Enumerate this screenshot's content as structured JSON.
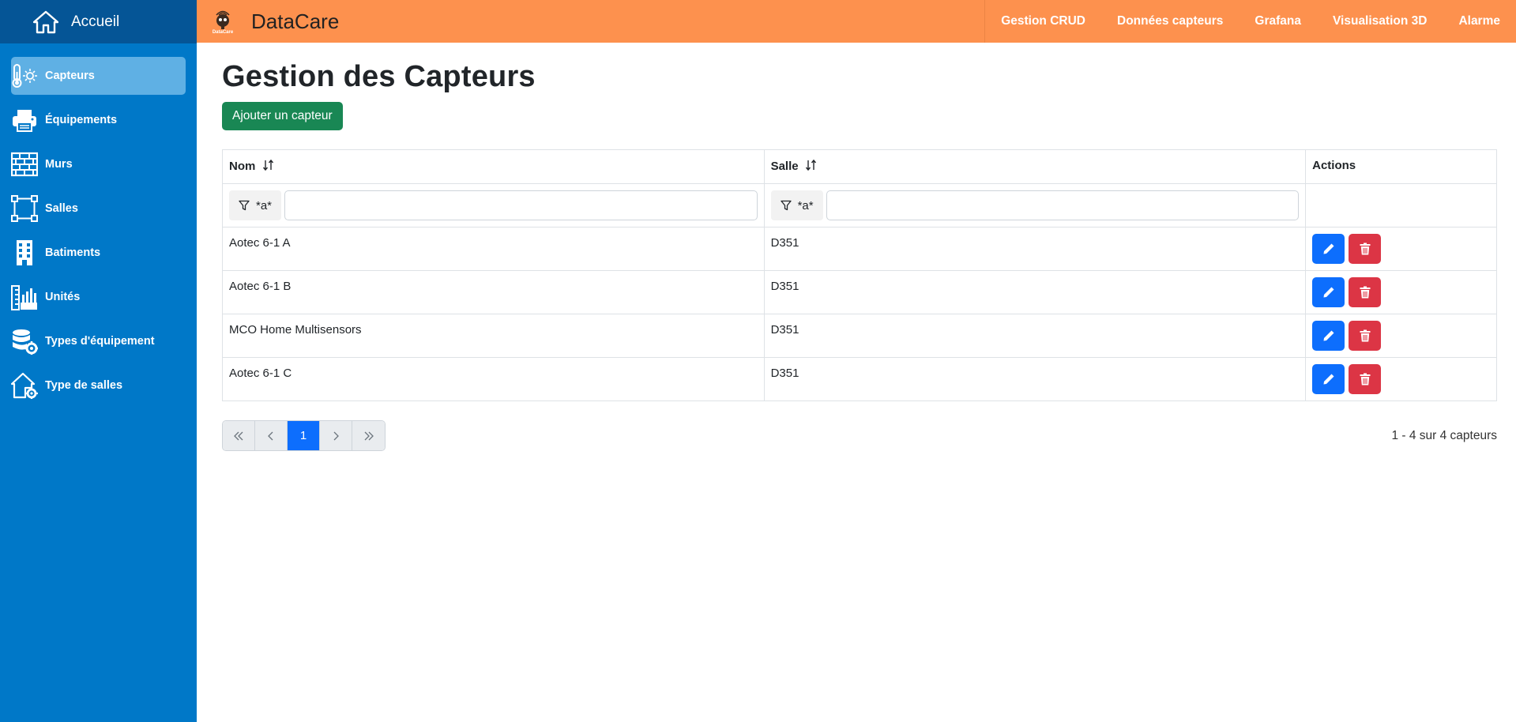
{
  "sidebar": {
    "home_label": "Accueil",
    "items": [
      {
        "label": "Capteurs",
        "icon": "thermometer-icon",
        "active": true
      },
      {
        "label": "Équipements",
        "icon": "printer-icon",
        "active": false
      },
      {
        "label": "Murs",
        "icon": "brick-wall-icon",
        "active": false
      },
      {
        "label": "Salles",
        "icon": "vector-square-icon",
        "active": false
      },
      {
        "label": "Batiments",
        "icon": "building-icon",
        "active": false
      },
      {
        "label": "Unités",
        "icon": "ruler-icon",
        "active": false
      },
      {
        "label": "Types d'équipement",
        "icon": "database-gear-icon",
        "active": false
      },
      {
        "label": "Type de salles",
        "icon": "house-gear-icon",
        "active": false
      }
    ]
  },
  "topbar": {
    "logo_text": "DataCare",
    "brand": "DataCare",
    "nav": [
      "Gestion CRUD",
      "Données capteurs",
      "Grafana",
      "Visualisation 3D",
      "Alarme"
    ]
  },
  "main": {
    "title": "Gestion des Capteurs",
    "add_button": "Ajouter un capteur",
    "table": {
      "headers": [
        "Nom",
        "Salle",
        "Actions"
      ],
      "filter_label": "*a*",
      "rows": [
        {
          "nom": "Aotec 6-1 A",
          "salle": "D351"
        },
        {
          "nom": "Aotec 6-1 B",
          "salle": "D351"
        },
        {
          "nom": "MCO Home Multisensors",
          "salle": "D351"
        },
        {
          "nom": "Aotec 6-1 C",
          "salle": "D351"
        }
      ]
    },
    "pagination": {
      "current_page": "1",
      "summary": "1 - 4 sur 4 capteurs"
    }
  },
  "colors": {
    "sidebar": "#0078c8",
    "sidebar_top": "#055596",
    "topbar": "#fd914e",
    "add_button": "#198754",
    "edit_button": "#0d6efd",
    "delete_button": "#dc3545"
  }
}
